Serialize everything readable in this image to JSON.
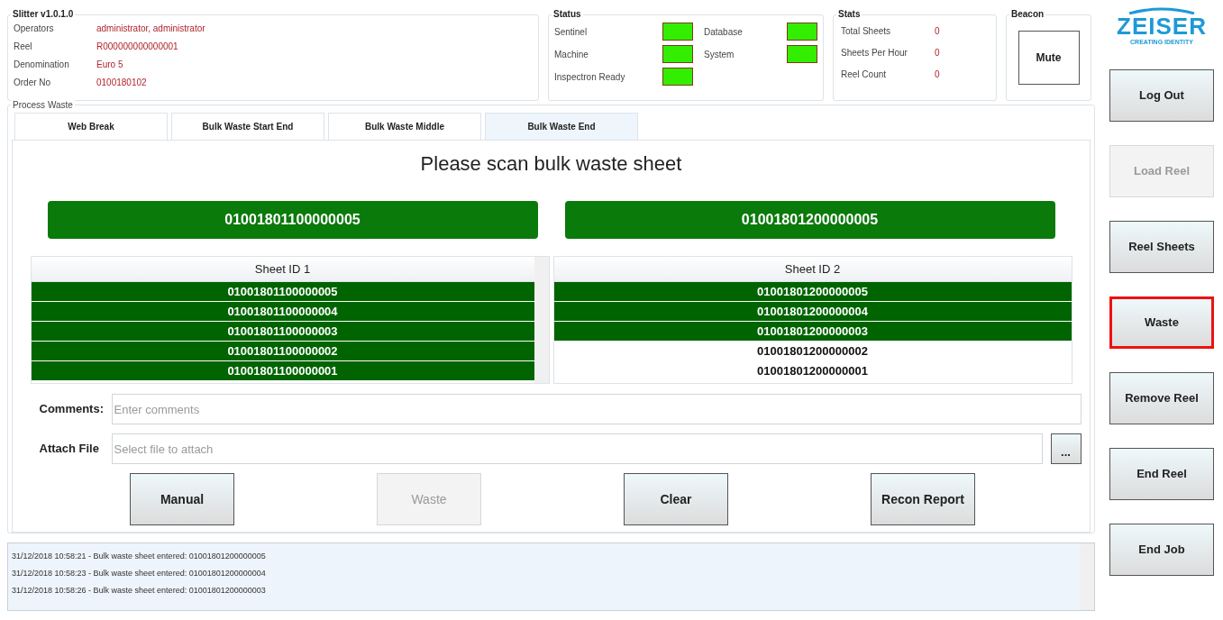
{
  "info": {
    "title": "Slitter v1.0.1.0",
    "fields": [
      {
        "label": "Operators",
        "value": "administrator, administrator"
      },
      {
        "label": "Reel",
        "value": "R000000000000001"
      },
      {
        "label": "Denomination",
        "value": "Euro 5"
      },
      {
        "label": "Order No",
        "value": "0100180102"
      }
    ]
  },
  "status": {
    "title": "Status",
    "indicators": [
      {
        "label": "Sentinel",
        "on": true
      },
      {
        "label": "Database",
        "on": true
      },
      {
        "label": "Machine",
        "on": true
      },
      {
        "label": "System",
        "on": true
      },
      {
        "label": "Inspectron Ready",
        "on": true
      }
    ]
  },
  "stats": {
    "title": "Stats",
    "items": [
      {
        "label": "Total Sheets",
        "value": "0"
      },
      {
        "label": "Sheets Per Hour",
        "value": "0"
      },
      {
        "label": "Reel Count",
        "value": "0"
      }
    ]
  },
  "beacon": {
    "title": "Beacon",
    "button": "Mute"
  },
  "logo": {
    "text": "ZEISER",
    "tagline": "CREATING IDENTITY"
  },
  "process": {
    "title": "Process Waste",
    "tabs": [
      {
        "label": "Web Break",
        "selected": false
      },
      {
        "label": "Bulk Waste Start End",
        "selected": false
      },
      {
        "label": "Bulk Waste Middle",
        "selected": false
      },
      {
        "label": "Bulk Waste End",
        "selected": true
      }
    ],
    "prompt": "Please scan bulk waste sheet",
    "scans": [
      "01001801100000005",
      "01001801200000005"
    ],
    "lists": [
      {
        "header": "Sheet ID 1",
        "rows": [
          {
            "text": "01001801100000005",
            "selected": true
          },
          {
            "text": "01001801100000004",
            "selected": true
          },
          {
            "text": "01001801100000003",
            "selected": true
          },
          {
            "text": "01001801100000002",
            "selected": true
          },
          {
            "text": "01001801100000001",
            "selected": true
          }
        ]
      },
      {
        "header": "Sheet ID 2",
        "rows": [
          {
            "text": "01001801200000005",
            "selected": true
          },
          {
            "text": "01001801200000004",
            "selected": true
          },
          {
            "text": "01001801200000003",
            "selected": true
          },
          {
            "text": "01001801200000002",
            "selected": false
          },
          {
            "text": "01001801200000001",
            "selected": false
          }
        ]
      }
    ],
    "comments": {
      "label": "Comments:",
      "placeholder": "Enter comments"
    },
    "attach": {
      "label": "Attach File",
      "placeholder": "Select file to attach",
      "browse": "..."
    },
    "buttons": [
      {
        "label": "Manual",
        "disabled": false
      },
      {
        "label": "Waste",
        "disabled": true
      },
      {
        "label": "Clear",
        "disabled": false
      },
      {
        "label": "Recon Report",
        "disabled": false
      }
    ]
  },
  "log": [
    "31/12/2018 10:58:21 - Bulk waste sheet entered: 01001801200000005",
    "31/12/2018 10:58:23 - Bulk waste sheet entered: 01001801200000004",
    "31/12/2018 10:58:26 - Bulk waste sheet entered: 01001801200000003"
  ],
  "side_buttons": [
    {
      "label": "Log Out",
      "disabled": false,
      "highlighted": false
    },
    {
      "label": "Load Reel",
      "disabled": true,
      "highlighted": false
    },
    {
      "label": "Reel Sheets",
      "disabled": false,
      "highlighted": false
    },
    {
      "label": "Waste",
      "disabled": false,
      "highlighted": true
    },
    {
      "label": "Remove Reel",
      "disabled": false,
      "highlighted": false
    },
    {
      "label": "End Reel",
      "disabled": false,
      "highlighted": false
    },
    {
      "label": "End Job",
      "disabled": false,
      "highlighted": false
    }
  ]
}
